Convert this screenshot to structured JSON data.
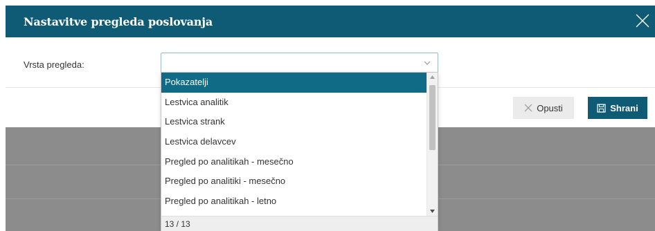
{
  "modal": {
    "title": "Nastavitve pregleda poslovanja",
    "field_label": "Vrsta pregleda:",
    "select_value": "",
    "cancel_label": "Opusti",
    "save_label": "Shrani"
  },
  "dropdown": {
    "items": [
      "Pokazatelji",
      "Lestvica analitik",
      "Lestvica strank",
      "Lestvica delavcev",
      "Pregled po analitikah - mesečno",
      "Pregled po analitiki - mesečno",
      "Pregled po analitikah - letno"
    ],
    "selected_index": 0,
    "count_text": "13 / 13"
  },
  "colors": {
    "header": "#0f5b75",
    "selected_item": "#0f6b86",
    "backdrop": "#8c8c8c"
  },
  "icons": {
    "close": "close-icon",
    "chevron": "chevron-down-icon",
    "cancel": "x-icon",
    "save": "floppy-disk-icon"
  }
}
